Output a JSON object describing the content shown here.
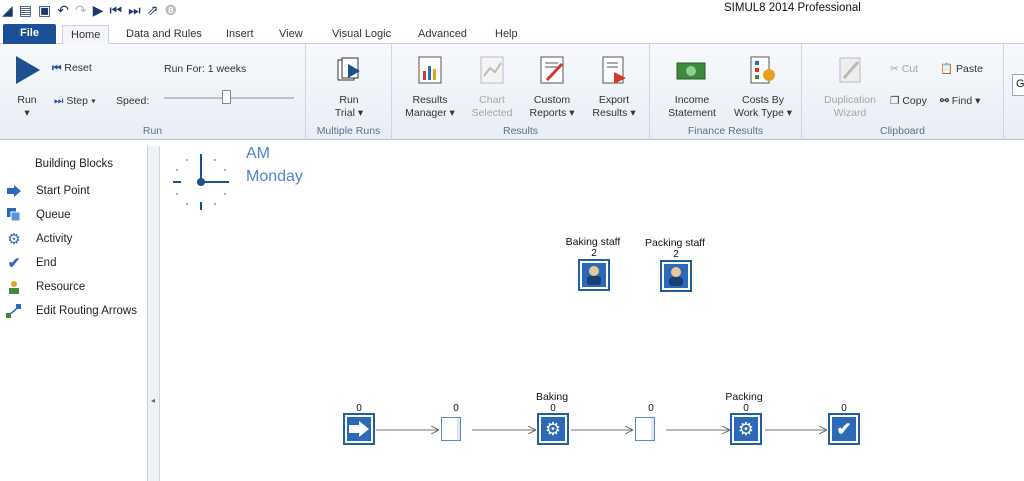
{
  "window": {
    "title": "SIMUL8 2014 Professional"
  },
  "tabs": [
    "File",
    "Home",
    "Data and Rules",
    "Insert",
    "View",
    "Visual Logic",
    "Advanced",
    "Help"
  ],
  "ribbon": {
    "run_group": {
      "run_label": "Run",
      "reset_label": "Reset",
      "step_label": "Step",
      "speed_label": "Speed:",
      "run_for_label": "Run For: 1 weeks",
      "group_label": "Run"
    },
    "multiple_runs": {
      "trial_line1": "Run",
      "trial_line2": "Trial",
      "group_label": "Multiple Runs"
    },
    "results": {
      "results_manager": [
        "Results",
        "Manager"
      ],
      "chart_selected": [
        "Chart",
        "Selected"
      ],
      "custom_reports": [
        "Custom",
        "Reports"
      ],
      "export_results": [
        "Export",
        "Results"
      ],
      "group_label": "Results"
    },
    "finance": {
      "income_statement": [
        "Income",
        "Statement"
      ],
      "costs_by_work_type": [
        "Costs By",
        "Work Type"
      ],
      "group_label": "Finance Results"
    },
    "clipboard": {
      "duplication_wizard": [
        "Duplication",
        "Wizard"
      ],
      "cut": "Cut",
      "copy": "Copy",
      "paste": "Paste",
      "find": "Find",
      "group_label": "Clipboard"
    },
    "overflow_text": "G"
  },
  "sidebar": {
    "title": "Building Blocks",
    "items": [
      {
        "label": "Start Point",
        "icon": "arrow-right-icon"
      },
      {
        "label": "Queue",
        "icon": "queue-icon"
      },
      {
        "label": "Activity",
        "icon": "gear-icon"
      },
      {
        "label": "End",
        "icon": "checkmark-icon"
      },
      {
        "label": "Resource",
        "icon": "person-icon"
      },
      {
        "label": "Edit Routing Arrows",
        "icon": "routing-arrows-icon"
      }
    ]
  },
  "clock": {
    "time": "AM",
    "day": "Monday"
  },
  "resources": [
    {
      "name": "Baking staff",
      "count": "2"
    },
    {
      "name": "Packing staff",
      "count": "2"
    }
  ],
  "flow": {
    "start": {
      "count": "0"
    },
    "queue1": {
      "count": "0"
    },
    "baking": {
      "name": "Baking",
      "count": "0"
    },
    "queue2": {
      "count": "0"
    },
    "packing": {
      "name": "Packing",
      "count": "0"
    },
    "end": {
      "count": "0"
    }
  },
  "colors": {
    "accent": "#1c5096",
    "object_blue": "#2a6ab8",
    "clock_text": "#4a86cf"
  }
}
